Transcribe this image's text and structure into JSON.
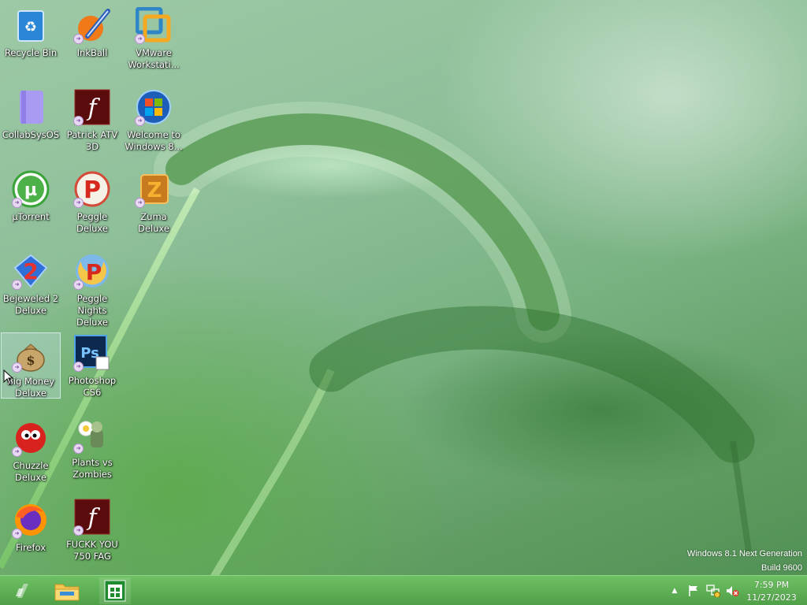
{
  "desktop": {
    "icons": [
      {
        "label": "Recycle Bin",
        "icon": "recycle-bin-icon",
        "selected": false
      },
      {
        "label": "InkBall",
        "icon": "inkball-icon",
        "selected": false
      },
      {
        "label": "VMware Workstati...",
        "icon": "vmware-icon",
        "selected": false
      },
      {
        "label": "CollabSysOS",
        "icon": "file-icon",
        "selected": false
      },
      {
        "label": "Patrick ATV 3D",
        "icon": "flash-icon",
        "selected": false
      },
      {
        "label": "Welcome to Windows 8...",
        "icon": "windows-orb-icon",
        "selected": false
      },
      {
        "label": "µTorrent",
        "icon": "utorrent-icon",
        "selected": false
      },
      {
        "label": "Peggle Deluxe",
        "icon": "peggle-icon",
        "selected": false
      },
      {
        "label": "Zuma Deluxe",
        "icon": "zuma-icon",
        "selected": false
      },
      {
        "label": "Bejeweled 2 Deluxe",
        "icon": "bejeweled-icon",
        "selected": false
      },
      {
        "label": "Peggle Nights Deluxe",
        "icon": "peggle-nights-icon",
        "selected": false
      },
      {
        "label": "Big Money Deluxe",
        "icon": "money-bag-icon",
        "selected": true
      },
      {
        "label": "Photoshop CS6",
        "icon": "photoshop-icon",
        "selected": false
      },
      {
        "label": "Chuzzle Deluxe",
        "icon": "chuzzle-icon",
        "selected": false
      },
      {
        "label": "Plants vs Zombies",
        "icon": "plants-vs-zombies-icon",
        "selected": false
      },
      {
        "label": "Firefox",
        "icon": "firefox-icon",
        "selected": false
      },
      {
        "label": "FUCKK YOU 750 FAG",
        "icon": "flash-icon",
        "selected": false
      }
    ]
  },
  "watermark": {
    "line1": "Windows 8.1 Next Generation",
    "line2": "Build 9600"
  },
  "taskbar": {
    "start_icon": "start-icon",
    "pinned": [
      {
        "name": "File Explorer",
        "icon": "folder-icon"
      },
      {
        "name": "Store",
        "icon": "store-icon"
      }
    ],
    "tray": {
      "time": "7:59 PM",
      "date": "11/27/2023",
      "icons": [
        "chevron-up-icon",
        "flag-icon",
        "network-icon",
        "speaker-muted-icon"
      ]
    }
  },
  "colors": {
    "taskbar": "#5aad52",
    "accent": "#2e9e3c"
  }
}
